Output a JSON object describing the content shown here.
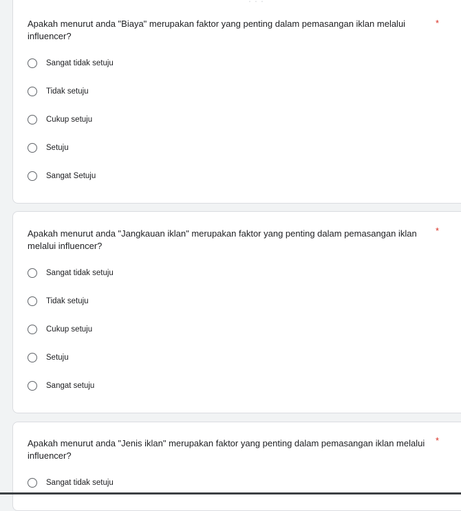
{
  "form": {
    "drag_handle_glyph": "⋮⋮⋮",
    "questions": [
      {
        "title": "Apakah menurut anda \"Biaya\" merupakan faktor yang penting dalam pemasangan iklan melalui influencer?",
        "required_mark": "*",
        "options": [
          "Sangat tidak setuju",
          "Tidak setuju",
          "Cukup setuju",
          "Setuju",
          "Sangat Setuju"
        ]
      },
      {
        "title": "Apakah menurut anda \"Jangkauan iklan\" merupakan faktor yang penting dalam  pemasangan iklan melalui influencer?",
        "required_mark": "*",
        "options": [
          "Sangat tidak setuju",
          "Tidak setuju",
          "Cukup setuju",
          "Setuju",
          "Sangat setuju"
        ]
      },
      {
        "title": "Apakah menurut anda \"Jenis iklan\" merupakan faktor yang penting dalam  pemasangan iklan melalui influencer?",
        "required_mark": "*",
        "options": [
          "Sangat tidak setuju"
        ]
      }
    ]
  },
  "colors": {
    "accent": "#673ab7",
    "required": "#d93025",
    "background": "#f1f3f4"
  }
}
